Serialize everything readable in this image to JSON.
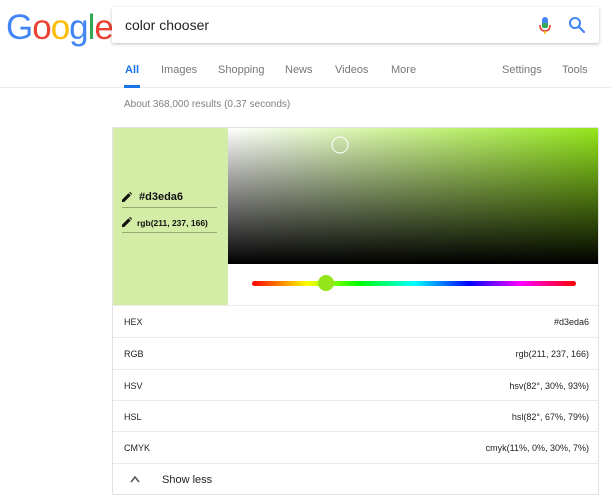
{
  "logo": {
    "letters": [
      "G",
      "o",
      "o",
      "g",
      "l",
      "e"
    ],
    "colors": [
      "#4285F4",
      "#EA4335",
      "#FBBC05",
      "#4285F4",
      "#34A853",
      "#EA4335"
    ]
  },
  "search": {
    "query": "color chooser",
    "mic_icon": "mic-icon",
    "search_icon": "search-icon"
  },
  "tabs": [
    {
      "label": "All",
      "active": true
    },
    {
      "label": "Images"
    },
    {
      "label": "Shopping"
    },
    {
      "label": "News"
    },
    {
      "label": "Videos"
    },
    {
      "label": "More"
    },
    {
      "label": "Settings"
    },
    {
      "label": "Tools"
    }
  ],
  "results_count": "About 368,000 results (0.37 seconds)",
  "color_picker": {
    "swatch_color": "#d3eda6",
    "hex_input": "#d3eda6",
    "rgb_input": "rgb(211, 237, 166)",
    "hue_deg": 82,
    "saturation": 0.3,
    "value": 0.93,
    "hue_color": "#94e61a",
    "handle_color": "#94e61a",
    "pencil_icon": "pencil-icon",
    "rows": [
      {
        "label": "HEX",
        "value": "#d3eda6"
      },
      {
        "label": "RGB",
        "value": "rgb(211, 237, 166)"
      },
      {
        "label": "HSV",
        "value": "hsv(82°, 30%, 93%)"
      },
      {
        "label": "HSL",
        "value": "hsl(82°, 67%, 79%)"
      },
      {
        "label": "CMYK",
        "value": "cmyk(11%, 0%, 30%, 7%)"
      }
    ],
    "show_less": "Show less"
  },
  "colors": {
    "accent_blue": "#1a73e8",
    "tab_inactive": "#777777"
  }
}
